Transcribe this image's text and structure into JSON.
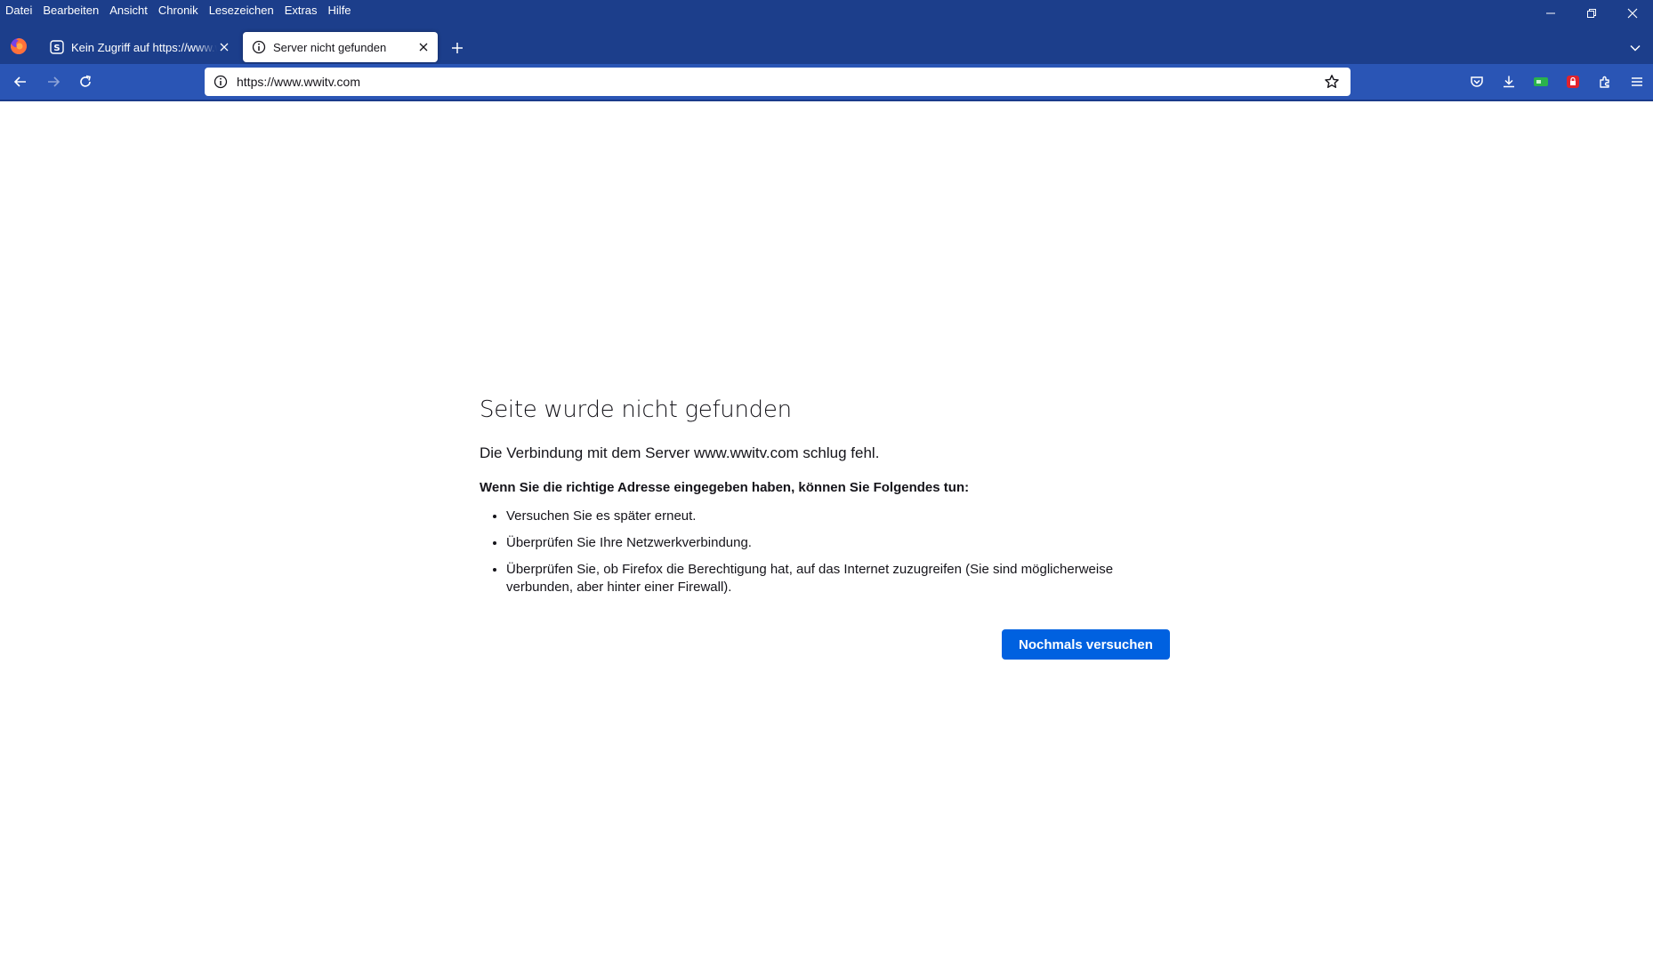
{
  "menu": {
    "items": [
      "Datei",
      "Bearbeiten",
      "Ansicht",
      "Chronik",
      "Lesezeichen",
      "Extras",
      "Hilfe"
    ]
  },
  "window_controls": {
    "icons": [
      "minimize-icon",
      "restore-icon",
      "close-icon"
    ]
  },
  "tabs": [
    {
      "label": "Kein Zugriff auf https://www.wwitv.com",
      "icon": "site-favicon",
      "active": false
    },
    {
      "label": "Server nicht gefunden",
      "icon": "info-icon",
      "active": true
    }
  ],
  "navbar": {
    "url": "https://www.wwitv.com",
    "icons": [
      "back-icon",
      "forward-icon",
      "reload-icon",
      "star-icon",
      "pocket-icon",
      "download-icon",
      "extension-green-icon",
      "extension-red-icon",
      "extensions-icon",
      "menu-icon"
    ]
  },
  "error": {
    "title": "Seite wurde nicht gefunden",
    "description": "Die Verbindung mit dem Server www.wwitv.com schlug fehl.",
    "hint": "Wenn Sie die richtige Adresse eingegeben haben, können Sie Folgendes tun:",
    "suggestions": [
      "Versuchen Sie es später erneut.",
      "Überprüfen Sie Ihre Netzwerkverbindung.",
      "Überprüfen Sie, ob Firefox die Berechtigung hat, auf das Internet zuzugreifen (Sie sind möglicherweise verbunden, aber hinter einer Firewall)."
    ],
    "retry_label": "Nochmals versuchen"
  },
  "colors": {
    "chrome": "#1c3e8b",
    "navbar": "#2a55b5",
    "accent_button": "#0061e0"
  }
}
